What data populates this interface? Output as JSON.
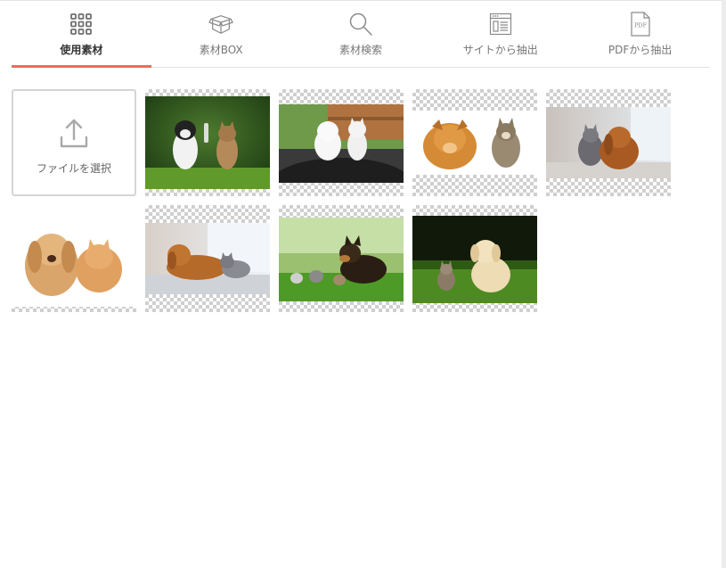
{
  "tabs": [
    {
      "label": "使用素材",
      "icon": "grid-icon",
      "active": true
    },
    {
      "label": "素材BOX",
      "icon": "box-icon",
      "active": false
    },
    {
      "label": "素材検索",
      "icon": "search-icon",
      "active": false
    },
    {
      "label": "サイトから抽出",
      "icon": "site-icon",
      "active": false
    },
    {
      "label": "PDFから抽出",
      "icon": "pdf-icon",
      "active": false
    }
  ],
  "pdf_icon_text": "PDF",
  "upload": {
    "label": "ファイルを選択",
    "icon": "upload-icon"
  },
  "colors": {
    "accent": "#ee6b5e",
    "icon_gray": "#8a8a8a"
  },
  "images": [
    {
      "subject": "puppy and kitten on grass, dark green background"
    },
    {
      "subject": "white puppy and white kitten on bench"
    },
    {
      "subject": "orange dog and tabby cat on white"
    },
    {
      "subject": "kitten and spaniel indoors"
    },
    {
      "subject": "cocker spaniel puppy and orange kitten on white"
    },
    {
      "subject": "golden retriever and grey cat lying on floor"
    },
    {
      "subject": "german shepherd with kittens on grass"
    },
    {
      "subject": "labrador puppy and kitten on grass, dark background"
    }
  ]
}
